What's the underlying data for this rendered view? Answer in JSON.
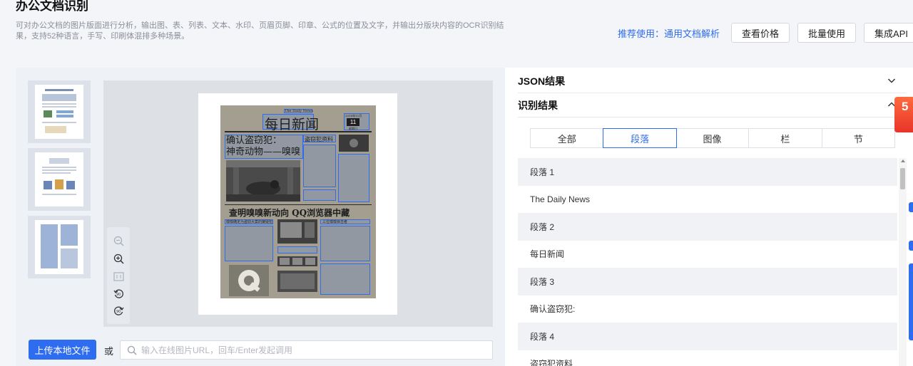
{
  "header": {
    "title": "办公文档识别",
    "description": "可对办公文档的图片版面进行分析，输出图、表、列表、文本、水印、页眉页脚、印章、公式的位置及文字，并输出分版块内容的OCR识别结果，支持52种语言，手写、印刷体混排多种场景。",
    "recommend_label": "推荐使用：",
    "recommend_link": "通用文档解析",
    "buttons": [
      "查看价格",
      "批量使用",
      "集成API"
    ]
  },
  "preview": {
    "newspaper": {
      "masthead_en": "The Daily News",
      "masthead_cn": "每日新闻",
      "date_text": "2018年11月",
      "date_day": "11",
      "date_week": "星期日",
      "headline_1": "确认盗窃犯：",
      "headline_2": "神奇动物——嗅嗅",
      "side_title": "盗窃犯资料",
      "headline_3": "查明嗅嗅新动向 QQ浏览器中藏",
      "sub_title_1": "嗅嗅确定为盗窃大案的嫌疑犯",
      "sub_title_2": "三位嗅嗅目击者"
    }
  },
  "upload": {
    "button": "上传本地文件",
    "or": "或",
    "url_placeholder": "输入在线图片URL，回车/Enter发起调用"
  },
  "results": {
    "json_title": "JSON结果",
    "ocr_title": "识别结果",
    "tabs": [
      "全部",
      "段落",
      "图像",
      "栏",
      "节"
    ],
    "active_tab": 1,
    "rows": [
      {
        "label": "段落 1",
        "header": true
      },
      {
        "label": "The Daily News",
        "header": false
      },
      {
        "label": "段落 2",
        "header": true
      },
      {
        "label": "每日新闻",
        "header": false
      },
      {
        "label": "段落 3",
        "header": true
      },
      {
        "label": "确认盗窃犯:",
        "header": false
      },
      {
        "label": "段落 4",
        "header": true
      },
      {
        "label": "盗窃犯资料",
        "header": false
      }
    ]
  },
  "promo": {
    "text": "5"
  },
  "colors": {
    "accent": "#2e6cf0",
    "promo": "#e8342a"
  }
}
